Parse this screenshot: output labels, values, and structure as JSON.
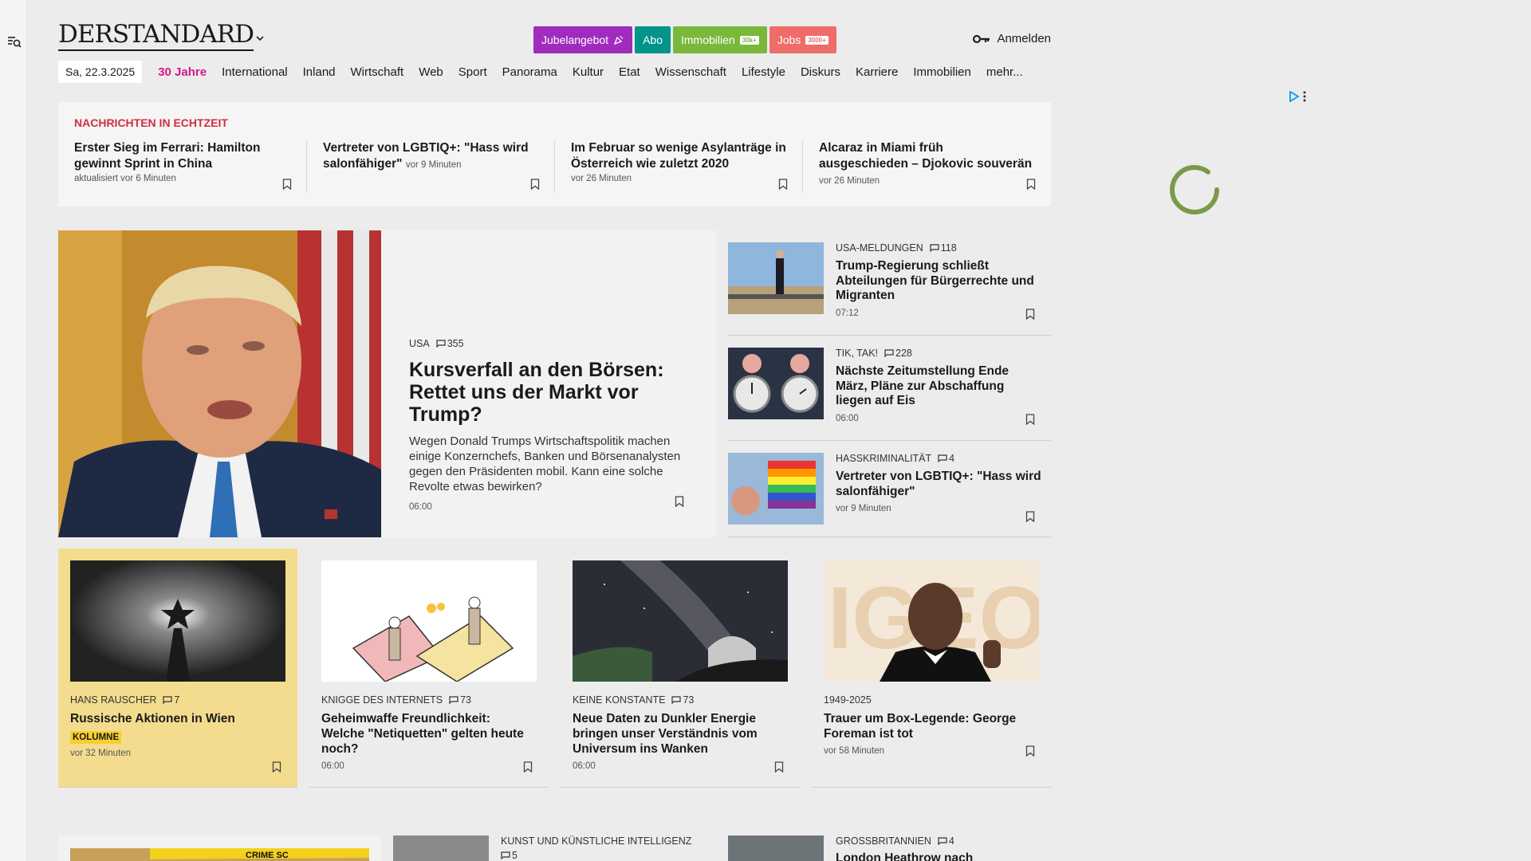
{
  "brand": {
    "logo": "DERSTANDARD"
  },
  "promo": [
    {
      "label": "Jubelangebot",
      "color": "#a02bbd",
      "tag": ""
    },
    {
      "label": "Abo",
      "color": "#00948a",
      "tag": ""
    },
    {
      "label": "Immobilien",
      "color": "#7ab83c",
      "tag": "30k+"
    },
    {
      "label": "Jobs",
      "color": "#ef6c69",
      "tag": "3000+"
    }
  ],
  "login": {
    "label": "Anmelden"
  },
  "nav": {
    "date": "Sa, 22.3.2025",
    "items": [
      "30 Jahre",
      "International",
      "Inland",
      "Wirtschaft",
      "Web",
      "Sport",
      "Panorama",
      "Kultur",
      "Etat",
      "Wissenschaft",
      "Lifestyle",
      "Diskurs",
      "Karriere",
      "Immobilien",
      "mehr..."
    ]
  },
  "ticker": {
    "title": "NACHRICHTEN IN ECHTZEIT",
    "items": [
      {
        "headline": "Erster Sieg im Ferrari: Hamilton gewinnt Sprint in China",
        "time": "aktualisiert vor 6 Minuten"
      },
      {
        "headline": "Vertreter von LGBTIQ+: \"Hass wird salonfähiger\"",
        "time": "vor 9 Minuten"
      },
      {
        "headline": "Im Februar so wenige Asylanträge in Österreich wie zuletzt 2020",
        "time": "vor 26 Minuten"
      },
      {
        "headline": "Alcaraz in Miami früh ausgeschieden – Djokovic souverän",
        "time": "vor 26 Minuten"
      }
    ]
  },
  "hero": {
    "kicker": "USA",
    "comments": "355",
    "title": "Kursverfall an den Börsen: Rettet uns der Markt vor Trump?",
    "lead": "Wegen Donald Trumps Wirtschaftspolitik machen einige Konzernchefs, Banken und Börsenanalysten gegen den Präsidenten mobil. Kann eine solche Revolte etwas bewirken?",
    "time": "06:00"
  },
  "side": [
    {
      "kicker": "USA-MELDUNGEN",
      "comments": "118",
      "title": "Trump-Regierung schließt Abteilungen für Bürgerrechte und Migranten",
      "time": "07:12"
    },
    {
      "kicker": "TIK, TAK!",
      "comments": "228",
      "title": "Nächste Zeitumstellung Ende März, Pläne zur Abschaffung liegen auf Eis",
      "time": "06:00"
    },
    {
      "kicker": "HASSKRIMINALITÄT",
      "comments": "4",
      "title": "Vertreter von LGBTIQ+: \"Hass wird salonfähiger\"",
      "time": "vor 9 Minuten"
    }
  ],
  "cards": [
    {
      "kicker": "HANS RAUSCHER",
      "comments": "7",
      "title": "Russische Aktionen in Wien",
      "badge": "KOLUMNE",
      "time": "vor 32 Minuten"
    },
    {
      "kicker": "KNIGGE DES INTERNETS",
      "comments": "73",
      "title": "Geheimwaffe Freundlichkeit: Welche \"Netiquetten\" gelten heute noch?",
      "badge": "",
      "time": "06:00"
    },
    {
      "kicker": "KEINE KONSTANTE",
      "comments": "73",
      "title": "Neue Daten zu Dunkler Energie bringen unser Verständnis vom Universum ins Wanken",
      "badge": "",
      "time": "06:00"
    },
    {
      "kicker": "1949-2025",
      "comments": "",
      "title": "Trauer um Box-Legende: George Foreman ist tot",
      "badge": "",
      "time": "vor 58 Minuten"
    }
  ],
  "bottom": {
    "image_text": "CRIME SC",
    "b2_kicker": "KUNST UND KÜNSTLICHE INTELLIGENZ",
    "b2_comments": "5",
    "b3_kicker": "GROSSBRITANNIEN",
    "b3_comments": "4",
    "b3_title": "London Heathrow nach"
  }
}
